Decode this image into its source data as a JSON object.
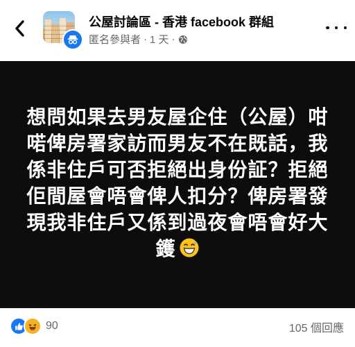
{
  "header": {
    "group_name": "公屋討論區 - 香港 facebook 群組",
    "author": "匿名參與者",
    "separator": "·",
    "time_ago": "1 天",
    "separator2": "·",
    "audience_icon": "globe-icon",
    "back_icon": "chevron-left-icon",
    "more_icon": "more-horizontal-icon"
  },
  "post": {
    "text": "想問如果去男友屋企住（公屋）咁喏俾房署家訪而男友不在既話，我係非住戶可否拒絕出身份証？拒絕佢間屋會唔會俾人扣分？俾房署發現我非住戶又係到過夜會唔會好大鑊",
    "emoji": "grinning-sweat-emoji",
    "background_color": "#0d0d0d"
  },
  "footer": {
    "reaction_icons": [
      "like-icon",
      "haha-icon"
    ],
    "reaction_count": "90",
    "comment_count": "105 個回應"
  },
  "colors": {
    "accent": "#1877f2",
    "secondary_text": "#65676b"
  }
}
